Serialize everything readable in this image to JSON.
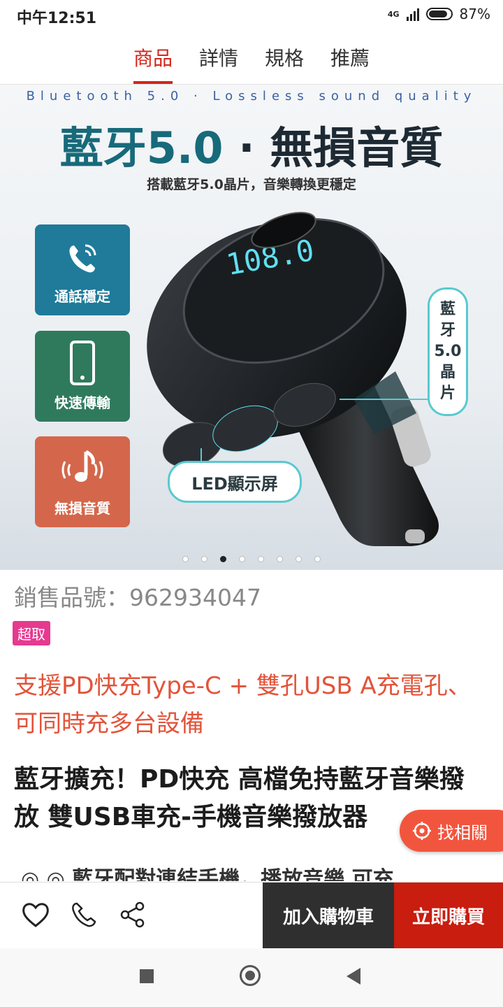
{
  "status": {
    "time": "中午12:51",
    "network": "4G",
    "battery": "87%",
    "battery_level": 0.87
  },
  "tabs": [
    {
      "label": "商品",
      "active": true
    },
    {
      "label": "詳情",
      "active": false
    },
    {
      "label": "規格",
      "active": false
    },
    {
      "label": "推薦",
      "active": false
    }
  ],
  "hero": {
    "subtitle": "Bluetooth 5.0 · Lossless sound quality",
    "title_part1": "藍牙5.0",
    "title_sep": "·",
    "title_part2": "無損音質",
    "desc": "搭載藍牙5.0晶片，音樂轉換更穩定",
    "features": [
      "通話穩定",
      "快速傳輸",
      "無損音質"
    ],
    "chip_label": [
      "藍",
      "牙",
      "5.0",
      "晶",
      "片"
    ],
    "led_label": "LED顯示屏",
    "screen_value": "108.0",
    "carousel_total": 8,
    "carousel_active": 3
  },
  "product": {
    "sku": "銷售品號：962934047",
    "badge": "超取",
    "promo": "支援PD快充Type-C + 雙孔USB A充電孔、可同時充多台設備",
    "title": "藍牙擴充！PD快充 高檔免持藍牙音樂撥放 雙USB車充-手機音樂撥放器",
    "desc_peek": "◎ ◎ 藍牙配對連結手機，播放音樂 可充"
  },
  "related_button": "找相關",
  "bottom": {
    "cart_label": "加入購物車",
    "buy_label": "立即購買"
  },
  "colors": {
    "accent": "#d4251a",
    "buy": "#c81d0f",
    "cart": "#2f2f2f",
    "badge": "#e6398f",
    "promo": "#e2543b",
    "teal": "#59c9d0"
  }
}
